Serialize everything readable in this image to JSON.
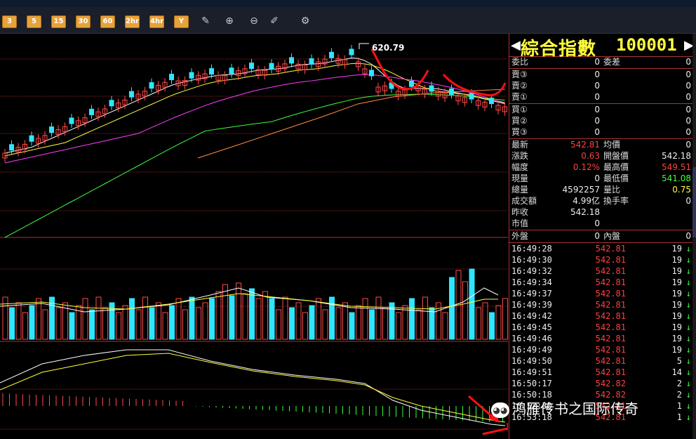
{
  "toolbar": {
    "period_buttons": [
      "3",
      "5",
      "15",
      "30",
      "60",
      "2hr",
      "4hr",
      "Y"
    ],
    "tool_icons": [
      "edit-icon",
      "zoom-in-icon",
      "zoom-out-icon",
      "pencil-icon",
      "gear-icon"
    ]
  },
  "chart": {
    "high_label": "620.79",
    "colors": {
      "up": "#ff4a4a",
      "down": "#2ee6ff",
      "ma5": "#ffffff",
      "ma10": "#ffff3c",
      "ma20": "#ff3cff",
      "ma60": "#3cff3c",
      "ma120": "#ff8c3c",
      "grid": "#8a1f1f",
      "annotation": "#ff1010"
    }
  },
  "panel": {
    "title_name": "綜合指數",
    "title_code": "100001",
    "committee": {
      "ratio_label": "委比",
      "ratio_value": "0",
      "diff_label": "委差",
      "diff_value": "0"
    },
    "asks": [
      {
        "label": "賣③",
        "price": "0",
        "volume": "0"
      },
      {
        "label": "賣②",
        "price": "0",
        "volume": "0"
      },
      {
        "label": "賣①",
        "price": "0",
        "volume": "0"
      }
    ],
    "bids": [
      {
        "label": "買①",
        "price": "0",
        "volume": "0"
      },
      {
        "label": "買②",
        "price": "0",
        "volume": "0"
      },
      {
        "label": "買③",
        "price": "0",
        "volume": "0"
      }
    ],
    "stats": [
      {
        "l1": "最新",
        "v1": "542.81",
        "c1": "red",
        "l2": "均價",
        "v2": "0",
        "c2": "white"
      },
      {
        "l1": "漲跌",
        "v1": "0.63",
        "c1": "red",
        "l2": "開盤價",
        "v2": "542.18",
        "c2": "white"
      },
      {
        "l1": "幅度",
        "v1": "0.12%",
        "c1": "red",
        "l2": "最高價",
        "v2": "549.51",
        "c2": "red"
      },
      {
        "l1": "現量",
        "v1": "0",
        "c1": "white",
        "l2": "最低價",
        "v2": "541.08",
        "c2": "green"
      },
      {
        "l1": "總量",
        "v1": "4592257",
        "c1": "white",
        "l2": "量比",
        "v2": "0.75",
        "c2": "yellow"
      },
      {
        "l1": "成交額",
        "v1": "4.99亿",
        "c1": "white",
        "l2": "換手率",
        "v2": "0",
        "c2": "white"
      },
      {
        "l1": "昨收",
        "v1": "542.18",
        "c1": "white",
        "l2": "",
        "v2": "",
        "c2": "white"
      },
      {
        "l1": "市值",
        "v1": "0",
        "c1": "white",
        "l2": "",
        "v2": "",
        "c2": "white"
      }
    ],
    "outer": {
      "label": "外盤",
      "value": "0",
      "inner_label": "內盤",
      "inner_value": "0"
    },
    "ticks": [
      {
        "time": "16:49:28",
        "price": "542.81",
        "vol": "19",
        "pc": "red"
      },
      {
        "time": "16:49:30",
        "price": "542.81",
        "vol": "19",
        "pc": "red"
      },
      {
        "time": "16:49:32",
        "price": "542.81",
        "vol": "19",
        "pc": "red"
      },
      {
        "time": "16:49:34",
        "price": "542.81",
        "vol": "19",
        "pc": "red"
      },
      {
        "time": "16:49:37",
        "price": "542.81",
        "vol": "19",
        "pc": "red"
      },
      {
        "time": "16:49:39",
        "price": "542.81",
        "vol": "19",
        "pc": "red"
      },
      {
        "time": "16:49:42",
        "price": "542.81",
        "vol": "19",
        "pc": "red"
      },
      {
        "time": "16:49:45",
        "price": "542.81",
        "vol": "19",
        "pc": "red"
      },
      {
        "time": "16:49:46",
        "price": "542.81",
        "vol": "19",
        "pc": "red"
      },
      {
        "time": "16:49:49",
        "price": "542.81",
        "vol": "19",
        "pc": "red"
      },
      {
        "time": "16:49:50",
        "price": "542.81",
        "vol": "5",
        "pc": "red"
      },
      {
        "time": "16:49:51",
        "price": "542.81",
        "vol": "14",
        "pc": "red"
      },
      {
        "time": "16:50:17",
        "price": "542.82",
        "vol": "2",
        "pc": "red"
      },
      {
        "time": "16:50:18",
        "price": "542.82",
        "vol": "2",
        "pc": "red"
      },
      {
        "time": "16:52:30",
        "price": "542.81",
        "vol": "1",
        "pc": "red"
      },
      {
        "time": "16:53:18",
        "price": "542.81",
        "vol": "1",
        "pc": "red"
      }
    ],
    "tick_arrow": "↓"
  },
  "watermark": "鸿雁传书之国际传奇"
}
